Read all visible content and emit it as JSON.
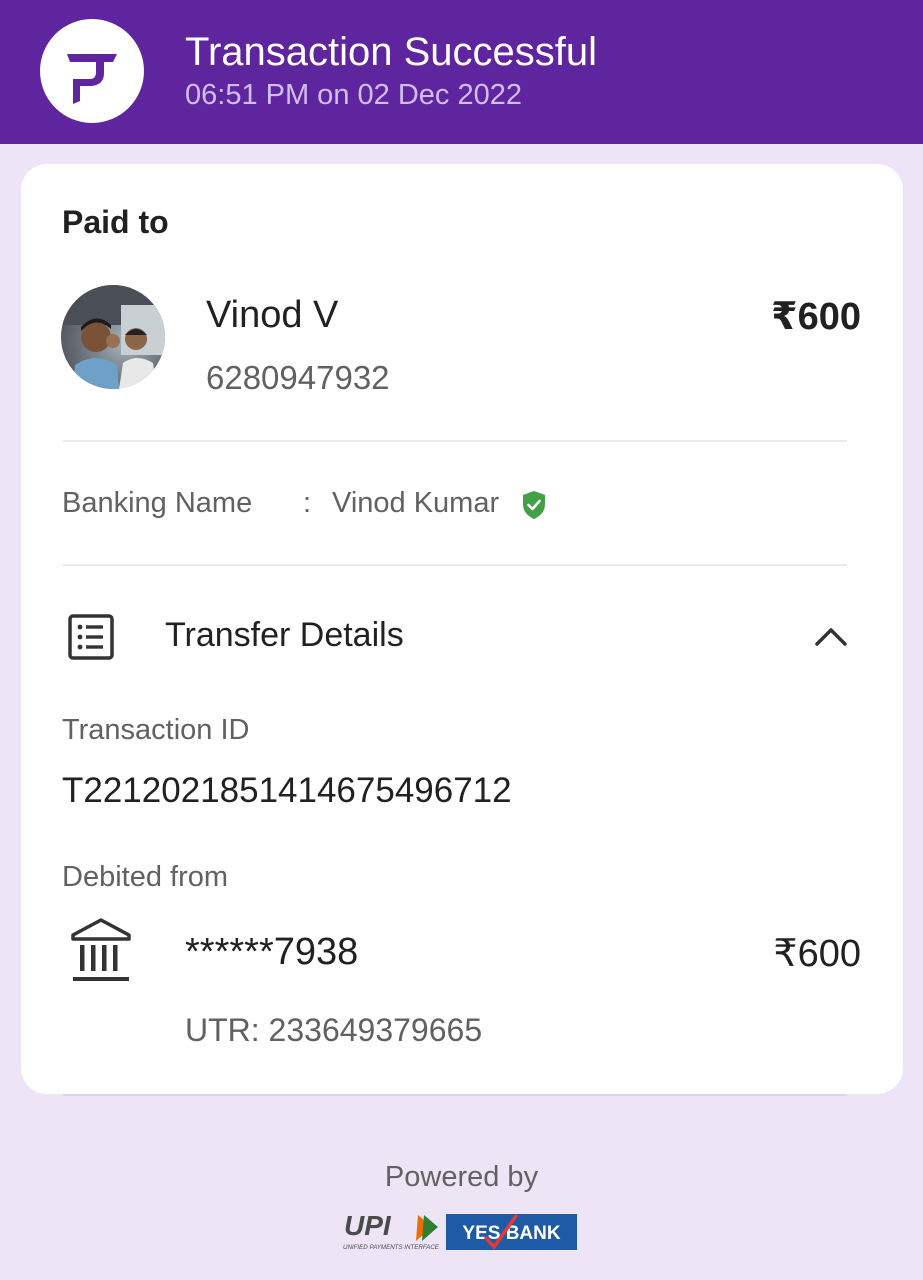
{
  "header": {
    "title": "Transaction Successful",
    "datetime": "06:51 PM on 02 Dec 2022",
    "logo_icon": "phonepe-logo",
    "bg_color": "#5f259f"
  },
  "payee": {
    "section_label": "Paid to",
    "name": "Vinod V",
    "phone": "6280947932",
    "amount": "₹600"
  },
  "banking": {
    "label": "Banking Name",
    "separator": ":",
    "value": "Vinod Kumar",
    "verified_icon": "verified-shield-icon",
    "verified_color": "#43a047"
  },
  "transfer": {
    "title": "Transfer Details",
    "icon": "list-icon",
    "toggle_icon": "chevron-up-icon",
    "transaction_id_label": "Transaction ID",
    "transaction_id": "T2212021851414675496712",
    "debited_label": "Debited from",
    "bank_icon": "bank-icon",
    "account": "******7938",
    "amount": "₹600",
    "utr": "UTR: 233649379665"
  },
  "footer": {
    "powered_by": "Powered by",
    "upi_text": "UPI",
    "upi_subtext": "UNIFIED PAYMENTS INTERFACE",
    "bank_text": "YES BANK"
  }
}
